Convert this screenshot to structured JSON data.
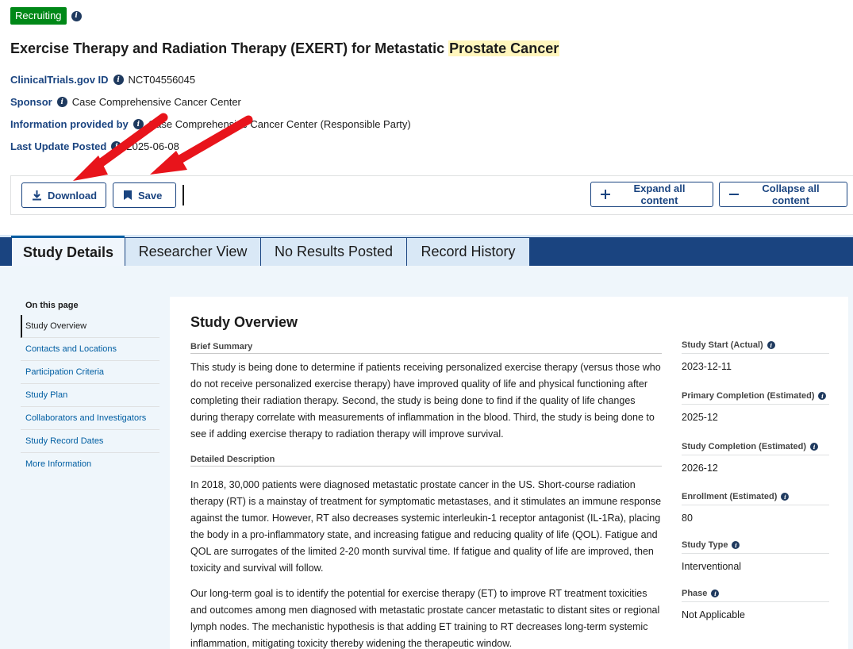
{
  "status": {
    "badge": "Recruiting"
  },
  "title": {
    "prefix": "Exercise Therapy and Radiation Therapy (EXERT) for Metastatic ",
    "highlight": "Prostate Cancer"
  },
  "meta": [
    {
      "key": "ClinicalTrials.gov ID",
      "value": "NCT04556045"
    },
    {
      "key": "Sponsor",
      "value": "Case Comprehensive Cancer Center"
    },
    {
      "key": "Information provided by",
      "value": "Case Comprehensive Cancer Center (Responsible Party)"
    },
    {
      "key": "Last Update Posted",
      "value": "2025-06-08"
    }
  ],
  "actions": {
    "download": "Download",
    "save": "Save",
    "expand": "Expand all content",
    "collapse": "Collapse all content"
  },
  "tabs": [
    {
      "label": "Study Details"
    },
    {
      "label": "Researcher View"
    },
    {
      "label": "No Results Posted"
    },
    {
      "label": "Record History"
    }
  ],
  "sidebar": {
    "heading": "On this page",
    "items": [
      {
        "label": "Study Overview"
      },
      {
        "label": "Contacts and Locations"
      },
      {
        "label": "Participation Criteria"
      },
      {
        "label": "Study Plan"
      },
      {
        "label": "Collaborators and Investigators"
      },
      {
        "label": "Study Record Dates"
      },
      {
        "label": "More Information"
      }
    ]
  },
  "overview": {
    "heading": "Study Overview",
    "brief_label": "Brief Summary",
    "brief_text": "This study is being done to determine if patients receiving personalized exercise therapy (versus those who do not receive personalized exercise therapy) have improved quality of life and physical functioning after completing their radiation therapy. Second, the study is being done to find if the quality of life changes during therapy correlate with measurements of inflammation in the blood. Third, the study is being done to see if adding exercise therapy to radiation therapy will improve survival.",
    "detailed_label": "Detailed Description",
    "detailed_p1": "In 2018, 30,000 patients were diagnosed metastatic prostate cancer in the US. Short-course radiation therapy (RT) is a mainstay of treatment for symptomatic metastases, and it stimulates an immune response against the tumor. However, RT also decreases systemic interleukin-1 receptor antagonist (IL-1Ra), placing the body in a pro-inflammatory state, and increasing fatigue and reducing quality of life (QOL). Fatigue and QOL are surrogates of the limited 2-20 month survival time. If fatigue and quality of life are improved, then toxicity and survival will follow.",
    "detailed_p2": "Our long-term goal is to identify the potential for exercise therapy (ET) to improve RT treatment toxicities and outcomes among men diagnosed with metastatic prostate cancer metastatic to distant sites or regional lymph nodes. The mechanistic hypothesis is that adding ET training to RT decreases long-term systemic inflammation, mitigating toxicity thereby widening the therapeutic window."
  },
  "facts": [
    {
      "key": "Study Start (Actual)",
      "value": "2023-12-11"
    },
    {
      "key": "Primary Completion (Estimated)",
      "value": "2025-12"
    },
    {
      "key": "Study Completion (Estimated)",
      "value": "2026-12"
    },
    {
      "key": "Enrollment (Estimated)",
      "value": "80"
    },
    {
      "key": "Study Type",
      "value": "Interventional"
    },
    {
      "key": "Phase",
      "value": "Not Applicable"
    }
  ],
  "colors": {
    "recruiting": "#008817",
    "primary": "#1a4480",
    "link": "#005ea2",
    "highlight": "#fff6bd",
    "annotation_arrow": "#e8141b"
  }
}
